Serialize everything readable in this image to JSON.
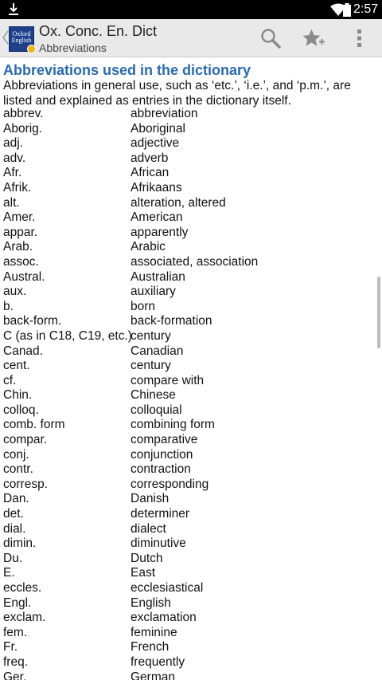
{
  "status_bar": {
    "time": "2:57",
    "icons": [
      "download-icon",
      "wifi-icon",
      "battery-icon"
    ]
  },
  "app_bar": {
    "title": "Ox. Conc. En. Dict",
    "subtitle": "Abbreviations",
    "logo_text": "Oxford English",
    "actions": [
      "search-icon",
      "bookmark-add-icon",
      "overflow-menu-icon"
    ]
  },
  "colors": {
    "heading": "#2a6ab0",
    "app_bar_bg": "#e9e9e9",
    "status_bar_bg": "#000000",
    "logo_bg": "#1e3f8a"
  },
  "page": {
    "heading": "Abbreviations used in the dictionary",
    "intro": "Abbreviations in general use, such as ‘etc.’, ‘i.e.’, and ‘p.m.’, are listed and explained as entries in the dictionary itself.",
    "rows": [
      {
        "abbr": "abbrev.",
        "meaning": "abbreviation"
      },
      {
        "abbr": "Aborig.",
        "meaning": "Aboriginal"
      },
      {
        "abbr": "adj.",
        "meaning": "adjective"
      },
      {
        "abbr": "adv.",
        "meaning": "adverb"
      },
      {
        "abbr": "Afr.",
        "meaning": "African"
      },
      {
        "abbr": "Afrik.",
        "meaning": "Afrikaans"
      },
      {
        "abbr": "alt.",
        "meaning": "alteration, altered"
      },
      {
        "abbr": "Amer.",
        "meaning": "American"
      },
      {
        "abbr": "appar.",
        "meaning": "apparently"
      },
      {
        "abbr": "Arab.",
        "meaning": "Arabic"
      },
      {
        "abbr": "assoc.",
        "meaning": "associated, association"
      },
      {
        "abbr": "Austral.",
        "meaning": "Australian"
      },
      {
        "abbr": "aux.",
        "meaning": "auxiliary"
      },
      {
        "abbr": "b.",
        "meaning": "born"
      },
      {
        "abbr": "back-form.",
        "meaning": "back-formation"
      },
      {
        "abbr": "C (as in C18, C19, etc.)",
        "meaning": "century"
      },
      {
        "abbr": "Canad.",
        "meaning": "Canadian"
      },
      {
        "abbr": "cent.",
        "meaning": "century"
      },
      {
        "abbr": "cf.",
        "meaning": "compare with"
      },
      {
        "abbr": "Chin.",
        "meaning": "Chinese"
      },
      {
        "abbr": "colloq.",
        "meaning": "colloquial"
      },
      {
        "abbr": "comb. form",
        "meaning": "combining form"
      },
      {
        "abbr": "compar.",
        "meaning": "comparative"
      },
      {
        "abbr": "conj.",
        "meaning": "conjunction"
      },
      {
        "abbr": "contr.",
        "meaning": "contraction"
      },
      {
        "abbr": "corresp.",
        "meaning": "corresponding"
      },
      {
        "abbr": "Dan.",
        "meaning": "Danish"
      },
      {
        "abbr": "det.",
        "meaning": "determiner"
      },
      {
        "abbr": "dial.",
        "meaning": "dialect"
      },
      {
        "abbr": "dimin.",
        "meaning": "diminutive"
      },
      {
        "abbr": "Du.",
        "meaning": "Dutch"
      },
      {
        "abbr": "E.",
        "meaning": "East"
      },
      {
        "abbr": "eccles.",
        "meaning": "ecclesiastical"
      },
      {
        "abbr": "Engl.",
        "meaning": "English"
      },
      {
        "abbr": "exclam.",
        "meaning": "exclamation"
      },
      {
        "abbr": "fem.",
        "meaning": "feminine"
      },
      {
        "abbr": "Fr.",
        "meaning": "French"
      },
      {
        "abbr": "freq.",
        "meaning": "frequently"
      },
      {
        "abbr": "Ger.",
        "meaning": "German"
      }
    ]
  }
}
